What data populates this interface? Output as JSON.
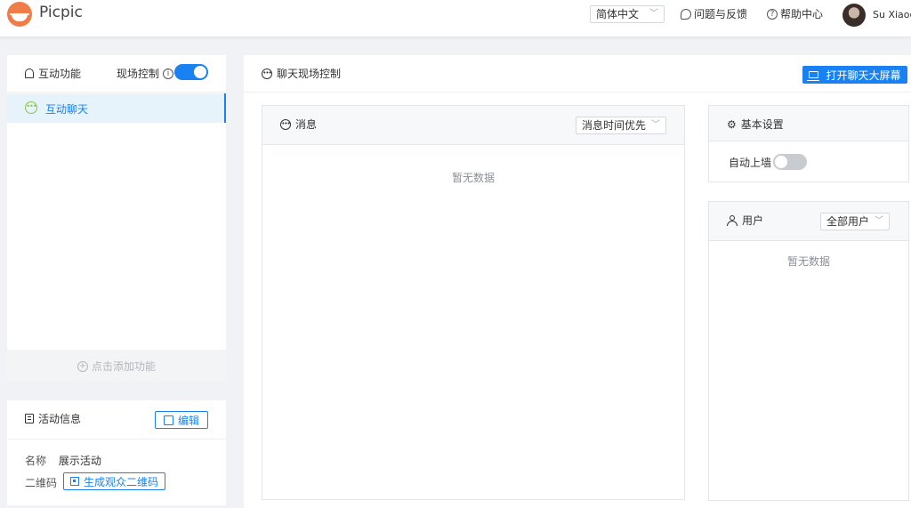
{
  "header": {
    "brand": "Picpic",
    "language": "简体中文",
    "feedback": "问题与反馈",
    "help": "帮助中心",
    "user_name": "Su Xiaoc"
  },
  "sidebar": {
    "title": "互动功能",
    "live_control_label": "现场控制",
    "live_control_on": true,
    "items": [
      {
        "label": "互动聊天",
        "active": true
      }
    ],
    "add_label": "点击添加功能"
  },
  "activity_info": {
    "title": "活动信息",
    "edit_label": "编辑",
    "name_key": "名称",
    "name_value": "展示活动",
    "qr_key": "二维码",
    "qr_button": "生成观众二维码"
  },
  "main": {
    "title": "聊天现场控制",
    "bigscreen_button": "打开聊天大屏幕",
    "messages": {
      "title": "消息",
      "sort_select": "消息时间优先",
      "empty": "暂无数据"
    },
    "settings": {
      "title": "基本设置",
      "auto_wall_label": "自动上墙",
      "auto_wall_on": false
    },
    "users": {
      "title": "用户",
      "filter_select": "全部用户",
      "empty": "暂无数据"
    }
  },
  "colors": {
    "primary": "#1a82f0",
    "logo": "#ef7d4a",
    "active_bg": "#e6f3fb",
    "chat_icon": "#8bc34a"
  }
}
